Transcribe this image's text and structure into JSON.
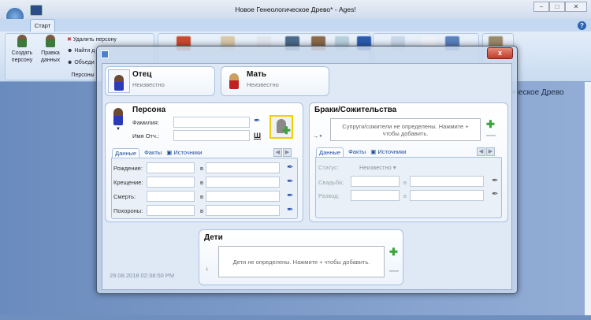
{
  "window": {
    "title": "Новое Генеологическое Древо* - Ages!",
    "controls": [
      "minimize",
      "maximize",
      "close"
    ]
  },
  "ribbon": {
    "tab": "Старт",
    "persons_group": {
      "label": "Персоны",
      "create": "Создать персону",
      "create_l1": "Создать",
      "create_l2": "персону",
      "edit_l1": "Правка",
      "edit_l2": "данных",
      "delete": "Удалить персону",
      "find": "Найти д",
      "merge": "Объеди"
    }
  },
  "background_text": "огическое Древо",
  "dialog": {
    "close": "x",
    "father": {
      "title": "Отец",
      "value": "Неизвестно"
    },
    "mother": {
      "title": "Мать",
      "value": "Неизвестно"
    },
    "person": {
      "title": "Персона",
      "surname_label": "Фамилия:",
      "surname_value": "",
      "name_label": "Имя Отч.:",
      "name_value": "",
      "gender_glyph": "Ш",
      "tabs": [
        "Данные",
        "Факты",
        "Источники"
      ],
      "rows": [
        {
          "label": "Рождение:",
          "date": "",
          "sep": "в",
          "place": ""
        },
        {
          "label": "Крещение:",
          "date": "",
          "sep": "в",
          "place": ""
        },
        {
          "label": "Смерть:",
          "date": "",
          "sep": "в",
          "place": ""
        },
        {
          "label": "Похороны:",
          "date": "",
          "sep": "в",
          "place": ""
        }
      ]
    },
    "marriages": {
      "title": "Браки/Сожительства",
      "empty_msg": "Супруги/сожители не определены. Нажмите + чтобы добавить.",
      "tabs": [
        "Данные",
        "Факты",
        "Источники"
      ],
      "status_label": "Статус:",
      "status_value": "Неизвестно",
      "rows": [
        {
          "label": "Свадьба:",
          "date": "",
          "sep": "в",
          "place": ""
        },
        {
          "label": "Развод:",
          "date": "",
          "sep": "в",
          "place": ""
        }
      ]
    },
    "children": {
      "title": "Дети",
      "empty_msg": "Дети не определены. Нажмите + чтобы добавить."
    },
    "timestamp": "29.08.2018 02:38:50 PM"
  },
  "colors": {
    "accent": "#1d4a9c",
    "plus": "#3aa33a",
    "close": "#c23a26"
  }
}
